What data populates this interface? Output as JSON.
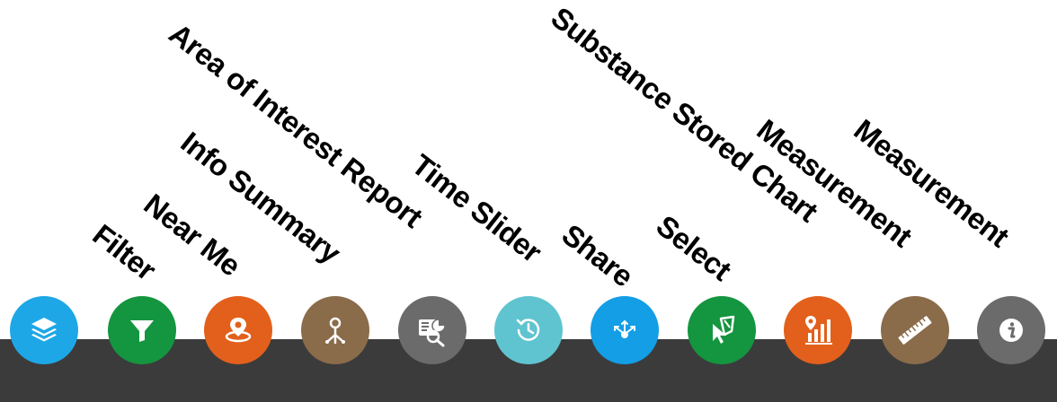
{
  "toolbar": {
    "tools": [
      {
        "name": "layers",
        "label": "",
        "icon": "layers-icon",
        "color": "#1ea7e6"
      },
      {
        "name": "filter",
        "label": "Filter",
        "icon": "filter-icon",
        "color": "#14953f"
      },
      {
        "name": "near-me",
        "label": "Near Me",
        "icon": "location-radius-icon",
        "color": "#e2601c"
      },
      {
        "name": "info-summary",
        "label": "Info Summary",
        "icon": "location-branch-icon",
        "color": "#8a6b4a"
      },
      {
        "name": "area-of-interest-report",
        "label": "Area of Interest Report",
        "icon": "report-search-icon",
        "color": "#6b6b6b"
      },
      {
        "name": "time-slider",
        "label": "Time Slider",
        "icon": "history-clock-icon",
        "color": "#5fc4cf"
      },
      {
        "name": "share",
        "label": "Share",
        "icon": "share-icon",
        "color": "#139ee6"
      },
      {
        "name": "select",
        "label": "Select",
        "icon": "select-cursor-icon",
        "color": "#14953f"
      },
      {
        "name": "substance-stored-chart",
        "label": "Substance Stored Chart",
        "icon": "bar-chart-pin-icon",
        "color": "#e2601c"
      },
      {
        "name": "measurement-1",
        "label": "Measurement",
        "icon": "ruler-icon",
        "color": "#8a6b4a"
      },
      {
        "name": "measurement-2",
        "label": "Measurement",
        "icon": "info-icon",
        "color": "#6b6b6b"
      }
    ]
  }
}
